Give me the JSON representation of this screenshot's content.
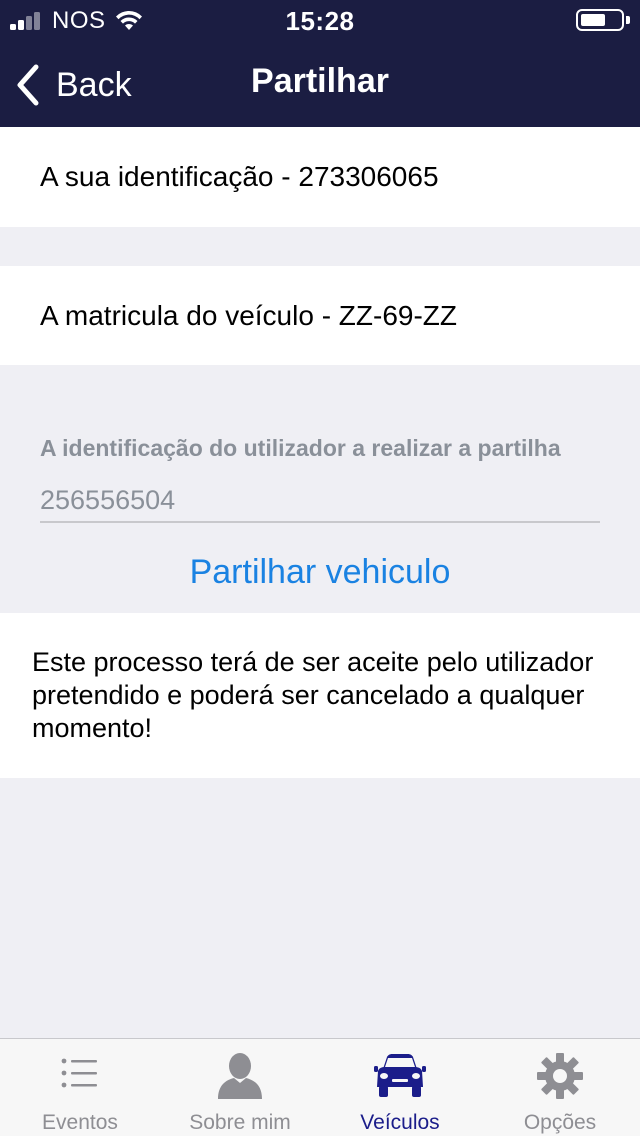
{
  "status_bar": {
    "carrier": "NOS",
    "time": "15:28"
  },
  "nav": {
    "back_label": "Back",
    "title": "Partilhar"
  },
  "identification": {
    "text": "A sua identificação - 273306065"
  },
  "vehicle": {
    "text": "A matricula do veículo - ZZ-69-ZZ"
  },
  "share_form": {
    "label": "A identificação do utilizador a realizar a partilha",
    "input_placeholder": "256556504",
    "input_value": "",
    "button_label": "Partilhar vehiculo"
  },
  "notice": {
    "text": "Este processo terá de ser aceite pelo utilizador pretendido e poderá ser cancelado a qualquer momento!"
  },
  "tab_bar": {
    "tabs": [
      {
        "label": "Eventos",
        "icon": "list-icon"
      },
      {
        "label": "Sobre mim",
        "icon": "person-icon"
      },
      {
        "label": "Veículos",
        "icon": "car-icon"
      },
      {
        "label": "Opções",
        "icon": "gear-icon"
      }
    ],
    "active_index": 2
  },
  "colors": {
    "header_bg": "#1b1d42",
    "accent": "#1a82e2",
    "tab_active": "#1b1d8a",
    "background": "#efeff4"
  }
}
